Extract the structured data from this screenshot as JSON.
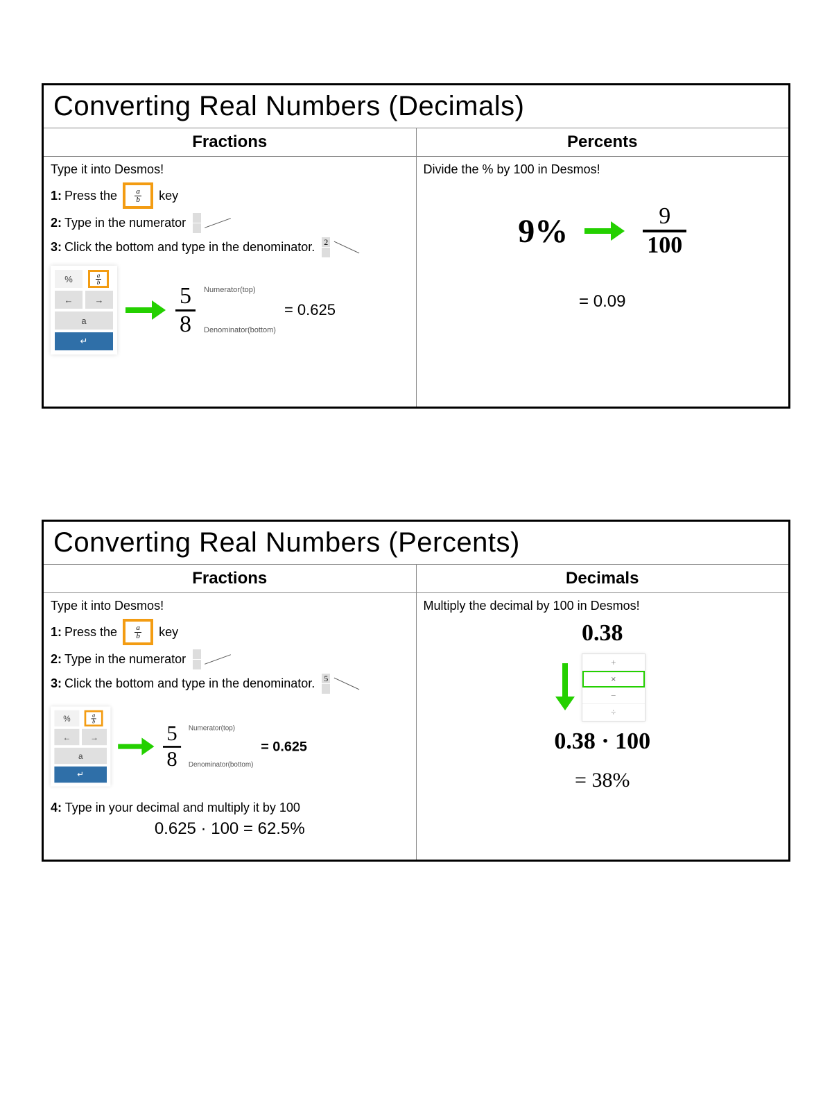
{
  "card1": {
    "title": "Converting Real Numbers (Decimals)",
    "left": {
      "header": "Fractions",
      "intro": "Type it into Desmos!",
      "step1_pre": "1:",
      "step1_a": "Press the",
      "step1_b": "key",
      "step2_pre": "2:",
      "step2": "Type in the numerator",
      "step3_pre": "3:",
      "step3": "Click the bottom and type in the denominator.",
      "kp_pct": "%",
      "kp_left": "←",
      "kp_right": "→",
      "kp_a": "a",
      "kp_enter": "↵",
      "frac_top": "5",
      "frac_bot": "8",
      "annot_top": "Numerator(top)",
      "annot_bot": "Denominator(bottom)",
      "eq": "= 0.625"
    },
    "right": {
      "header": "Percents",
      "intro": "Divide the % by 100 in Desmos!",
      "pct": "9%",
      "frac_top": "9",
      "frac_bot": "100",
      "eq": "= 0.09"
    }
  },
  "card2": {
    "title": "Converting Real Numbers (Percents)",
    "left": {
      "header": "Fractions",
      "intro": "Type it into Desmos!",
      "step1_pre": "1:",
      "step1_a": "Press the",
      "step1_b": "key",
      "step2_pre": "2:",
      "step2": "Type in the numerator",
      "step3_pre": "3:",
      "step3": "Click the bottom and type in the denominator.",
      "kp_pct": "%",
      "kp_left": "←",
      "kp_right": "→",
      "kp_a": "a",
      "kp_enter": "↵",
      "frac_top": "5",
      "frac_bot": "8",
      "annot_top": "Numerator(top)",
      "annot_bot": "Denominator(bottom)",
      "eq": "= 0.625",
      "step4_pre": "4:",
      "step4": "Type in your decimal and multiply it by 100",
      "step4_eq": "0.625 · 100 = 62.5%"
    },
    "right": {
      "header": "Decimals",
      "intro": "Multiply the decimal by 100 in Desmos!",
      "dec": "0.38",
      "op_plus": "+",
      "op_times": "×",
      "op_minus": "−",
      "op_div": "÷",
      "mult": "0.38 · 100",
      "eq": "= 38%"
    }
  },
  "frac_key": {
    "a": "a",
    "b": "b"
  },
  "mini_frac": {
    "two": "2",
    "five": "5"
  }
}
